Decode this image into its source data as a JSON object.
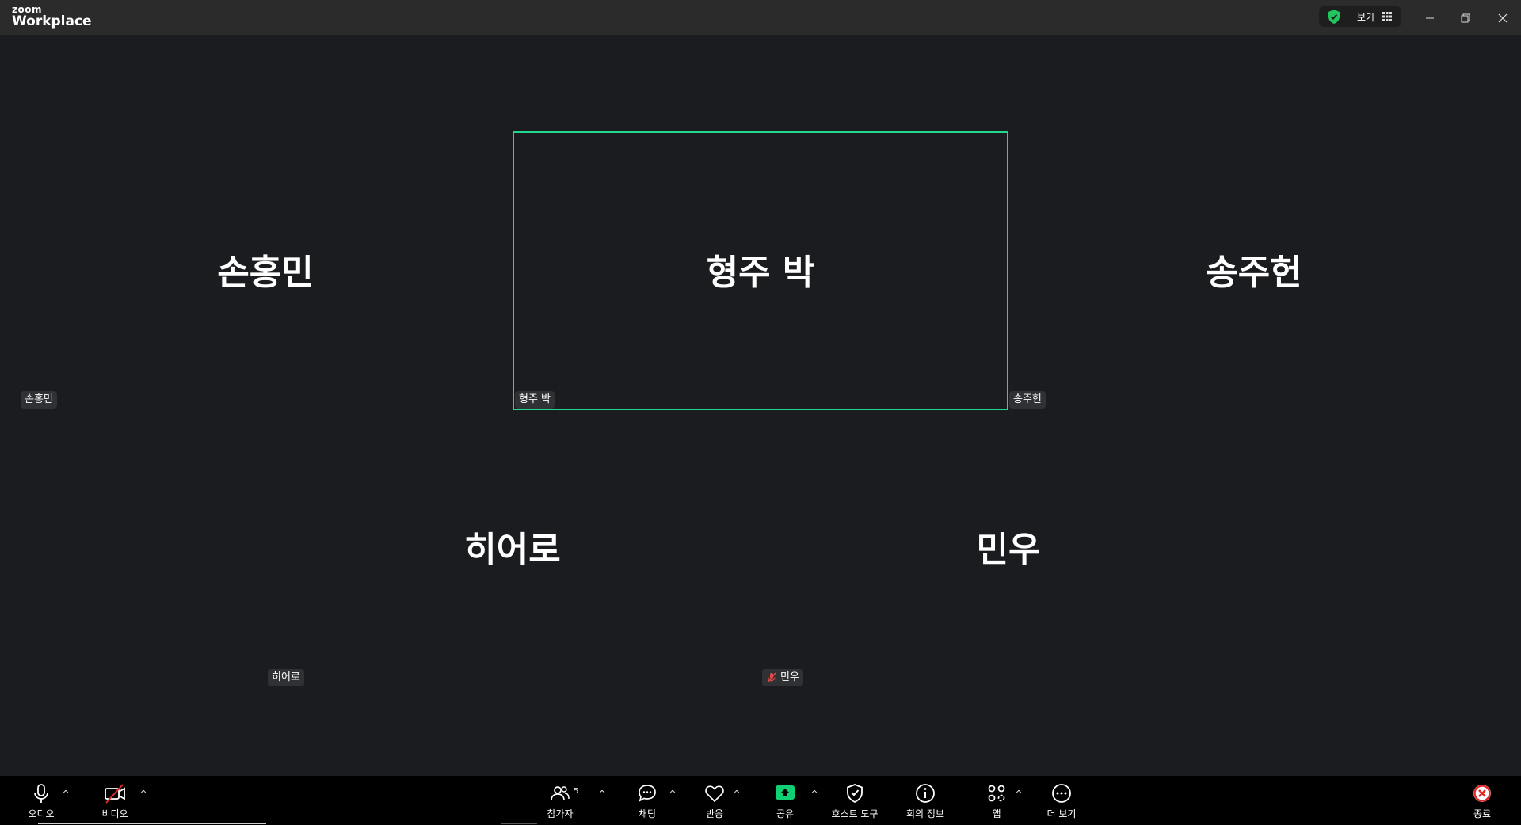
{
  "app": {
    "logo_small": "zoom",
    "logo_large": "Workplace",
    "view_label": "보기"
  },
  "participants": {
    "count": "5",
    "tiles": [
      {
        "name": "손홍민",
        "tag": "손홍민",
        "muted": false
      },
      {
        "name": "형주 박",
        "tag": "형주 박",
        "muted": false,
        "active_speaker": true
      },
      {
        "name": "송주헌",
        "tag": "송주헌",
        "muted": false
      },
      {
        "name": "히어로",
        "tag": "히어로",
        "muted": false
      },
      {
        "name": "민우",
        "tag": "민우",
        "muted": true
      }
    ]
  },
  "toolbar": {
    "audio": "오디오",
    "video": "비디오",
    "participants": "참가자",
    "chat": "채팅",
    "reactions": "반응",
    "share": "공유",
    "host_tools": "호스트 도구",
    "meeting_info": "회의 정보",
    "apps": "앱",
    "more": "더 보기",
    "end": "종료"
  },
  "colors": {
    "background": "#1a1c1f",
    "active_border": "#22d68e",
    "share_green": "#0fd173",
    "end_red": "#e02828",
    "muted_red": "#e84a4a"
  },
  "icons": [
    "shield-check-icon",
    "grid-icon",
    "minimize-icon",
    "restore-icon",
    "close-icon",
    "microphone-icon",
    "video-off-icon",
    "participants-icon",
    "chat-icon",
    "heart-icon",
    "share-screen-icon",
    "host-shield-icon",
    "info-icon",
    "apps-icon",
    "more-icon",
    "end-icon",
    "mic-muted-icon"
  ]
}
